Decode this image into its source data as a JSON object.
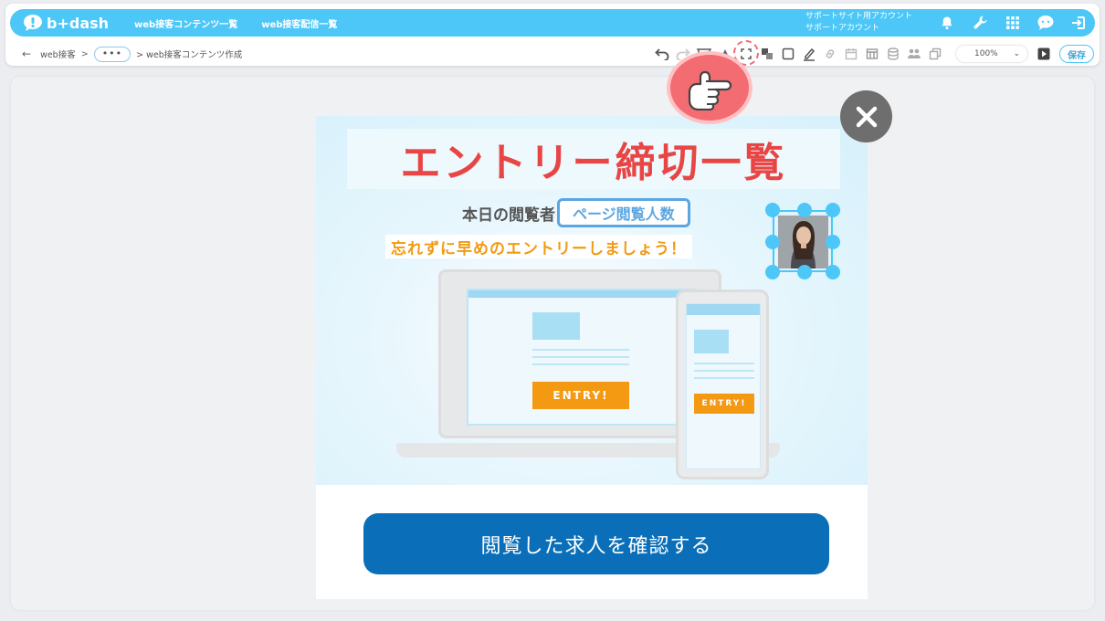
{
  "app": {
    "logo_text": "b+dash",
    "nav": [
      {
        "label": "web接客コンテンツ一覧"
      },
      {
        "label": "web接客配信一覧"
      }
    ],
    "account": {
      "line1": "サポートサイト用アカウント",
      "line2": "サポートアカウント"
    },
    "header_icons": [
      "bell-icon",
      "wrench-icon",
      "grid-icon",
      "chat-icon",
      "logout-icon"
    ]
  },
  "breadcrumb": {
    "back": "←",
    "root": "web接客",
    "sep": ">",
    "more": "•••",
    "current": "> web接客コンテンツ作成"
  },
  "toolbar": {
    "zoom": "100%",
    "zoom_caret": "⌄",
    "save_label": "保存"
  },
  "popup": {
    "title": "エントリー締切一覧",
    "viewers_label": "本日の閲覧者",
    "viewers_pill": "ページ閲覧人数",
    "subtitle": "忘れずに早めのエントリーしましょう！",
    "entry_label_laptop": "ENTRY!",
    "entry_label_phone": "ENTRY!",
    "cta_label": "閲覧した求人を確認する"
  },
  "colors": {
    "header": "#4cc7f7",
    "title": "#e84545",
    "subtitle": "#f29a12",
    "cta": "#0a6fb8",
    "pill": "#5ba6e0"
  }
}
